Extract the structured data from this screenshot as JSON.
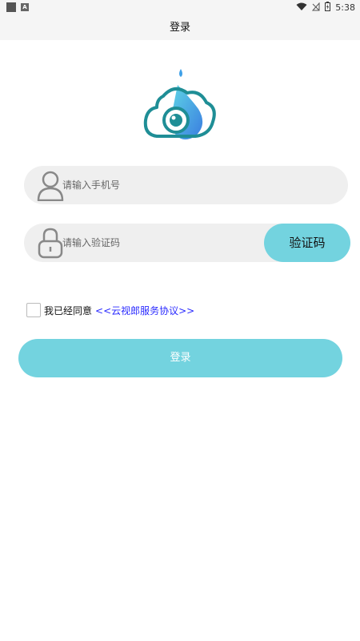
{
  "status_bar": {
    "time": "5:38",
    "icons": [
      "notification-square-icon",
      "a-icon",
      "wifi-icon",
      "signal-off-icon",
      "battery-icon"
    ]
  },
  "title": "登录",
  "phone": {
    "placeholder": "请输入手机号",
    "icon": "user-icon"
  },
  "code": {
    "placeholder": "请输入验证码",
    "icon": "lock-icon",
    "button_label": "验证码"
  },
  "agreement": {
    "text": "我已经同意",
    "link": "<<云视郎服务协议>>",
    "checked": false
  },
  "login_button": "登录",
  "colors": {
    "accent": "#73d3df",
    "field_bg": "#efefef",
    "link": "#2a2aff"
  }
}
